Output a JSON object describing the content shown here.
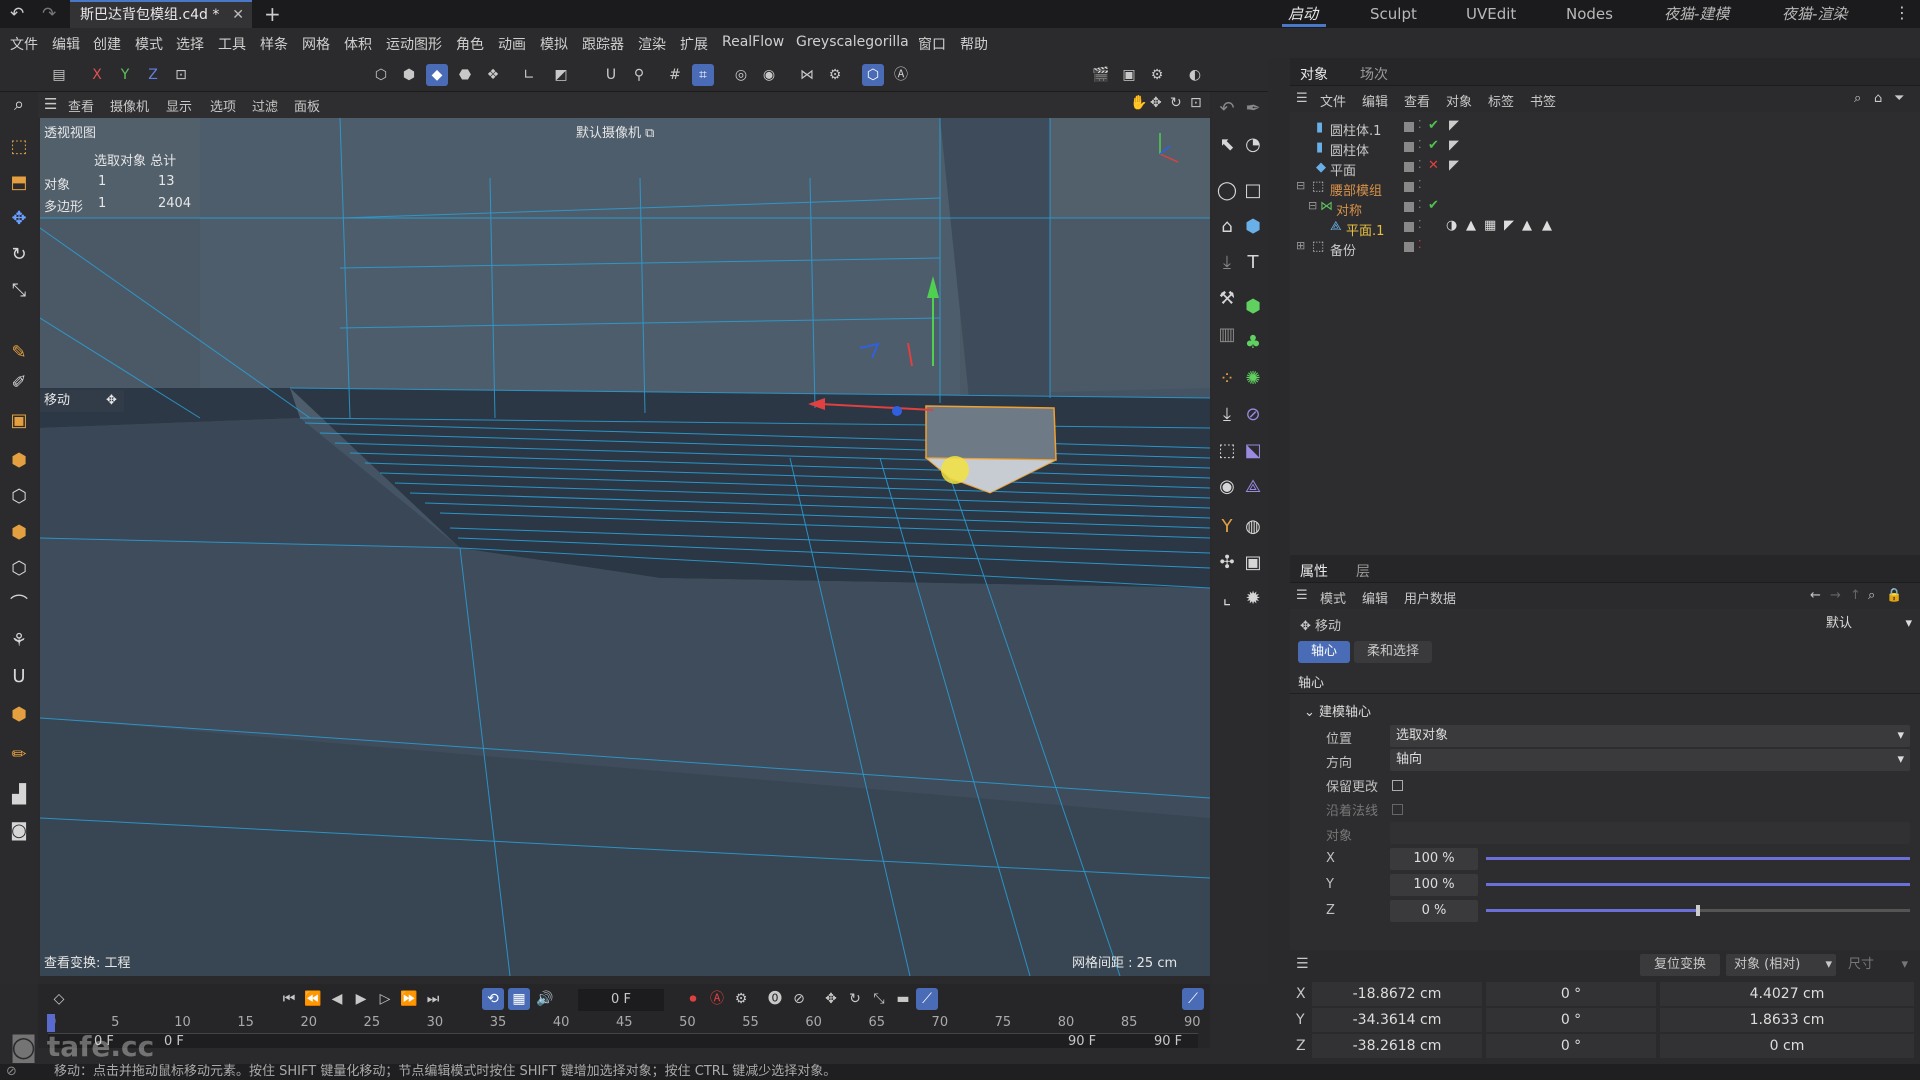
{
  "titlebar": {
    "tab_title": "斯巴达背包模组.c4d *",
    "layouts": [
      "启动",
      "Sculpt",
      "UVEdit",
      "Nodes",
      "夜猫-建模",
      "夜猫-渲染"
    ]
  },
  "menubar": [
    "文件",
    "编辑",
    "创建",
    "模式",
    "选择",
    "工具",
    "样条",
    "网格",
    "体积",
    "运动图形",
    "角色",
    "动画",
    "模拟",
    "跟踪器",
    "渲染",
    "扩展",
    "RealFlow",
    "Greyscalegorilla",
    "窗口",
    "帮助"
  ],
  "toolbar": {
    "axes": [
      "X",
      "Y",
      "Z"
    ]
  },
  "viewport": {
    "menu": [
      "查看",
      "摄像机",
      "显示",
      "选项",
      "过滤",
      "面板"
    ],
    "view_name": "透视视图",
    "camera": "默认摄像机",
    "stats_header": "选取对象 总计",
    "stats": [
      {
        "label": "对象",
        "sel": "1",
        "total": "13"
      },
      {
        "label": "多边形",
        "sel": "1",
        "total": "2404"
      }
    ],
    "tool_name": "移动",
    "view_transform": "查看变换: 工程",
    "grid_spacing": "网格间距 : 25 cm"
  },
  "object_panel": {
    "tabs": [
      "对象",
      "场次"
    ],
    "menu": [
      "文件",
      "编辑",
      "查看",
      "对象",
      "标签",
      "书签"
    ],
    "objects": [
      {
        "name": "圆柱体.1",
        "state": "check",
        "color": "#c8c8c8"
      },
      {
        "name": "圆柱体",
        "state": "check",
        "color": "#c8c8c8"
      },
      {
        "name": "平面",
        "state": "cross",
        "color": "#c8c8c8"
      },
      {
        "name": "腰部模组",
        "state": "none",
        "color": "#d8914a"
      },
      {
        "name": "对称",
        "state": "check",
        "color": "#d8914a"
      },
      {
        "name": "平面.1",
        "state": "none",
        "color": "#e8c040"
      },
      {
        "name": "备份",
        "state": "none",
        "color": "#c8c8c8"
      }
    ]
  },
  "attributes": {
    "tabs": [
      "属性",
      "层"
    ],
    "menu": [
      "模式",
      "编辑",
      "用户数据"
    ],
    "tool": "移动",
    "preset": "默认",
    "subtabs": [
      "轴心",
      "柔和选择"
    ],
    "section": "轴心",
    "group": "建模轴心",
    "position_label": "位置",
    "position_value": "选取对象",
    "direction_label": "方向",
    "direction_value": "轴向",
    "keep_changes": "保留更改",
    "along_normal": "沿着法线",
    "object_label": "对象",
    "xyz": [
      {
        "axis": "X",
        "value": "100 %",
        "pct": 1.0
      },
      {
        "axis": "Y",
        "value": "100 %",
        "pct": 1.0
      },
      {
        "axis": "Z",
        "value": "0 %",
        "pct": 0.5
      }
    ]
  },
  "coords": {
    "reset_button": "复位变换",
    "mode": "对象 (相对)",
    "size_label": "尺寸",
    "rows": [
      {
        "axis": "X",
        "pos": "-18.8672 cm",
        "rot": "0 °",
        "size": "4.4027 cm"
      },
      {
        "axis": "Y",
        "pos": "-34.3614 cm",
        "rot": "0 °",
        "size": "1.8633 cm"
      },
      {
        "axis": "Z",
        "pos": "-38.2618 cm",
        "rot": "0 °",
        "size": "0 cm"
      }
    ]
  },
  "timeline": {
    "current_frame": "0 F",
    "ticks": [
      "0",
      "5",
      "10",
      "15",
      "20",
      "25",
      "30",
      "35",
      "40",
      "45",
      "50",
      "55",
      "60",
      "65",
      "70",
      "75",
      "80",
      "85",
      "90"
    ],
    "start": "0 F",
    "start2": "0 F",
    "end": "90 F",
    "end2": "90 F"
  },
  "watermark": "tafe.cc",
  "status": "移动：点击并拖动鼠标移动元素。按住 SHIFT 键量化移动；节点编辑模式时按住 SHIFT 键增加选择对象；按住 CTRL 键减少选择对象。"
}
